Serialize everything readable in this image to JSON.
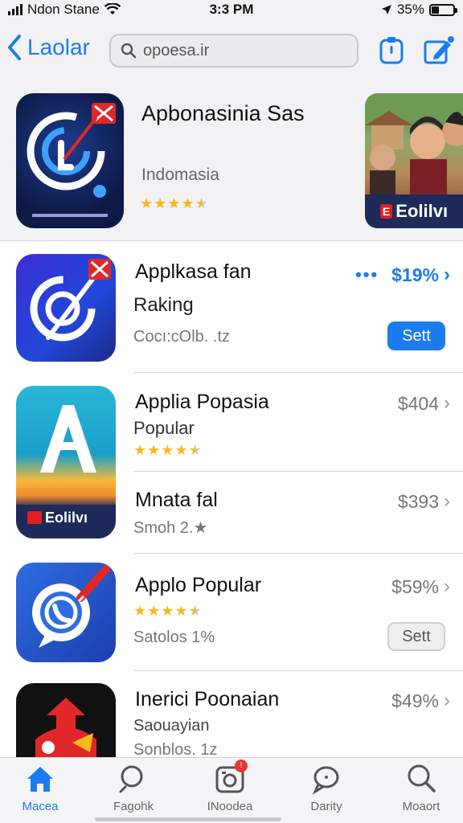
{
  "status_bar": {
    "carrier": "Ndon Stane",
    "time": "3:3 PM",
    "battery_text": "35%",
    "battery_level": 0.35
  },
  "nav": {
    "back_label": "Laolar",
    "search_value": "opoesa.ir"
  },
  "featured": {
    "title": "Apbonasinia Sas",
    "subtitle": "Indomasia",
    "rating": 4.5,
    "banner_text": "Eolilvı"
  },
  "apps": [
    {
      "title": "Applkasa fan",
      "subtitle": "Raking",
      "meta": "Cocı:cOlb. .tz",
      "price": "$19%",
      "button": "Sett",
      "highlight": true
    },
    {
      "title": "Applia Popasia",
      "subtitle": "Popular",
      "rating": 4.5,
      "price": "$404"
    },
    {
      "title": "Mnata fal",
      "meta": "Smoh 2.★",
      "price": "$393",
      "banner_text": "Eolilvı"
    },
    {
      "title": "Applo Popular",
      "rating": 4.5,
      "meta": "Satolos 1%",
      "price": "$59%",
      "button": "Sett"
    },
    {
      "title": "Inerici Poonaian",
      "subtitle": "Saouayian",
      "meta": "Sonblos. 1z",
      "price": "$49%"
    }
  ],
  "tabs": [
    {
      "label": "Macea",
      "icon": "home-icon",
      "active": true
    },
    {
      "label": "Fagohk",
      "icon": "search-icon"
    },
    {
      "label": "INoodea",
      "icon": "camera-icon",
      "badge": true
    },
    {
      "label": "Darity",
      "icon": "message-icon"
    },
    {
      "label": "Moaort",
      "icon": "search-icon"
    }
  ],
  "colors": {
    "accent": "#1a7cf0",
    "star": "#f5b91b",
    "badge": "#e53935"
  }
}
